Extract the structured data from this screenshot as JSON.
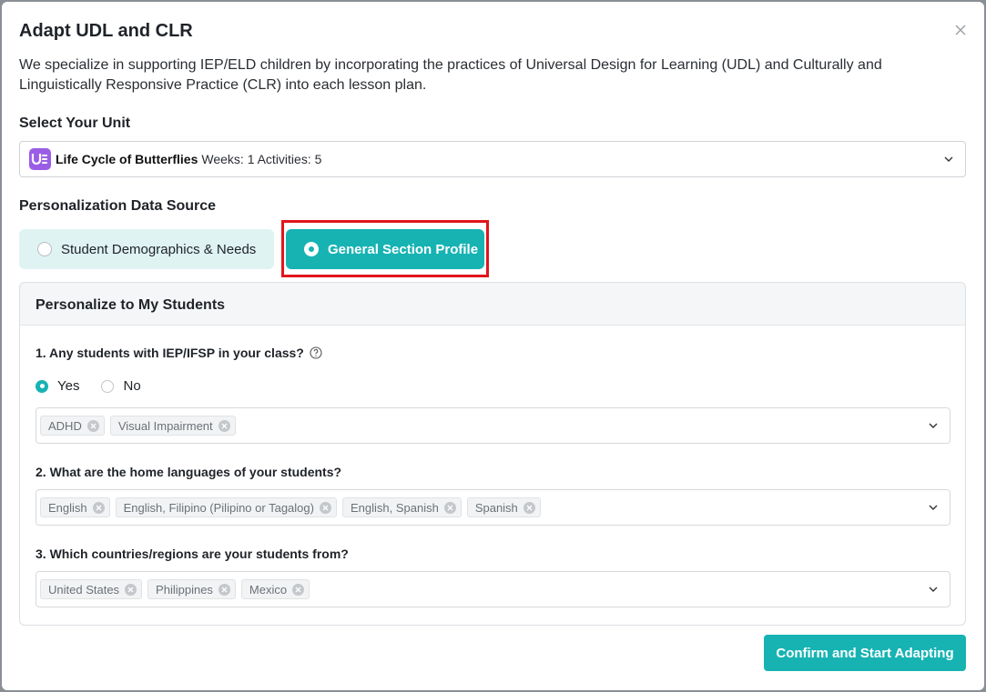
{
  "modal": {
    "title": "Adapt UDL and CLR",
    "description": "We specialize in supporting IEP/ELD children by incorporating the practices of Universal Design for Learning (UDL) and Culturally and Linguistically Responsive Practice (CLR) into each lesson plan.",
    "close_icon": "close-icon"
  },
  "unit": {
    "label": "Select Your Unit",
    "name": "Life Cycle of Butterflies",
    "meta": "Weeks: 1 Activities: 5",
    "logo_letter": "U"
  },
  "source": {
    "label": "Personalization Data Source",
    "options": [
      {
        "label": "Student Demographics & Needs",
        "selected": false
      },
      {
        "label": "General Section Profile",
        "selected": true
      }
    ]
  },
  "personalize": {
    "title": "Personalize to My Students",
    "q1": {
      "label": "1. Any students with IEP/IFSP in your class?",
      "yes": "Yes",
      "no": "No",
      "selected": "Yes",
      "tags": [
        "ADHD",
        "Visual Impairment"
      ]
    },
    "q2": {
      "label": "2. What are the home languages of your students?",
      "tags": [
        "English",
        "English, Filipino (Pilipino or Tagalog)",
        "English, Spanish",
        "Spanish"
      ]
    },
    "q3": {
      "label": "3. Which countries/regions are your students from?",
      "tags": [
        "United States",
        "Philippines",
        "Mexico"
      ]
    }
  },
  "confirm_label": "Confirm and Start Adapting",
  "colors": {
    "accent": "#17b3b3",
    "accent_light": "#dff3f3",
    "highlight": "#e0161b",
    "unit_logo": "#9b5de5"
  }
}
